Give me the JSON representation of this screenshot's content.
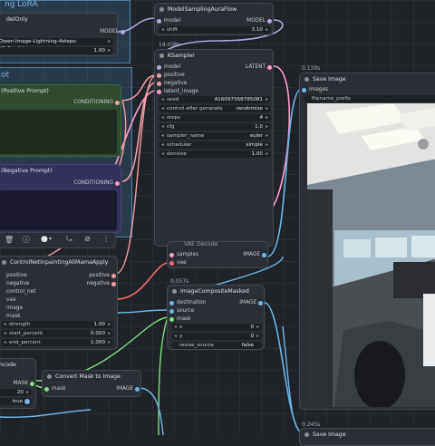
{
  "nodes": {
    "lora_group_title": "ng LoRA",
    "prompt_group_title": "ot",
    "model_only": {
      "title": "delOnly",
      "output": "MODEL",
      "lora_name": "Qwen-Image-Lightning-4steps-V1.0.safetensors",
      "strength": "1.00"
    },
    "sampling_aura": {
      "title": "ModelSamplingAuraFlow",
      "input": "model",
      "output": "MODEL",
      "shift_label": "shift",
      "shift_value": "3.10"
    },
    "ksampler": {
      "time": "14.038s",
      "title": "KSampler",
      "inputs": [
        "model",
        "positive",
        "negative",
        "latent_image"
      ],
      "output": "LATENT",
      "widgets": [
        {
          "k": "seed",
          "v": "416097568785081"
        },
        {
          "k": "control after generate",
          "v": "randomize"
        },
        {
          "k": "steps",
          "v": "4"
        },
        {
          "k": "cfg",
          "v": "1.0"
        },
        {
          "k": "sampler_name",
          "v": "euler"
        },
        {
          "k": "scheduler",
          "v": "simple"
        },
        {
          "k": "denoise",
          "v": "1.00"
        }
      ]
    },
    "positive_prompt": {
      "title": "(Positive Prompt)",
      "output": "CONDITIONING"
    },
    "negative_prompt": {
      "title": "(Negative Prompt)",
      "output": "CONDITIONING"
    },
    "vae_decode": {
      "title": "VAE Decode",
      "inputs": [
        "samples",
        "vae"
      ],
      "output": "IMAGE"
    },
    "controlnet": {
      "title": "ControlNetInpaintingAliMamaApply",
      "inputs": [
        "positive",
        "negative",
        "control_net",
        "vae",
        "image",
        "mask"
      ],
      "outputs": [
        "positive",
        "negative"
      ],
      "widgets": [
        {
          "k": "strength",
          "v": "1.00"
        },
        {
          "k": "start_percent",
          "v": "0.000"
        },
        {
          "k": "end_percent",
          "v": "1.000"
        }
      ]
    },
    "save_image": {
      "time": "0.139s",
      "title": "Save Image",
      "input": "images",
      "prefix": "filename_prefix"
    },
    "composite": {
      "time": "0.057s",
      "title": "ImageCompositeMasked",
      "inputs": [
        "destination",
        "source",
        "mask"
      ],
      "output": "IMAGE",
      "widgets": [
        {
          "k": "x",
          "v": "0"
        },
        {
          "k": "y",
          "v": "0"
        },
        {
          "k": "resize_source",
          "v": "false"
        }
      ]
    },
    "mask_to_image": {
      "title": "Convert Mask to Image",
      "input": "mask",
      "output": "IMAGE"
    },
    "encode": {
      "title": "ncode",
      "output": "MASK",
      "grow_value": "20",
      "toggle_value": "true"
    },
    "save_image2": {
      "time": "0.245s",
      "title": "Save Image"
    }
  },
  "toolbar": {
    "icons": [
      "trash-icon",
      "info-icon",
      "color-icon",
      "bypass-icon",
      "more-icon"
    ]
  },
  "colors": {
    "background": "#1f2227",
    "group": "#3d6e96",
    "node": "#2b2f35",
    "positive": "#2f4a2f",
    "negative": "#33305a",
    "model_wire": "#b3a6e3",
    "conditioning_wire": "#f1a0a4",
    "image_wire": "#6db7e8",
    "mask_wire": "#7fe07f",
    "vae_wire": "#f26b6b",
    "latent_wire": "#ff9fcf"
  }
}
